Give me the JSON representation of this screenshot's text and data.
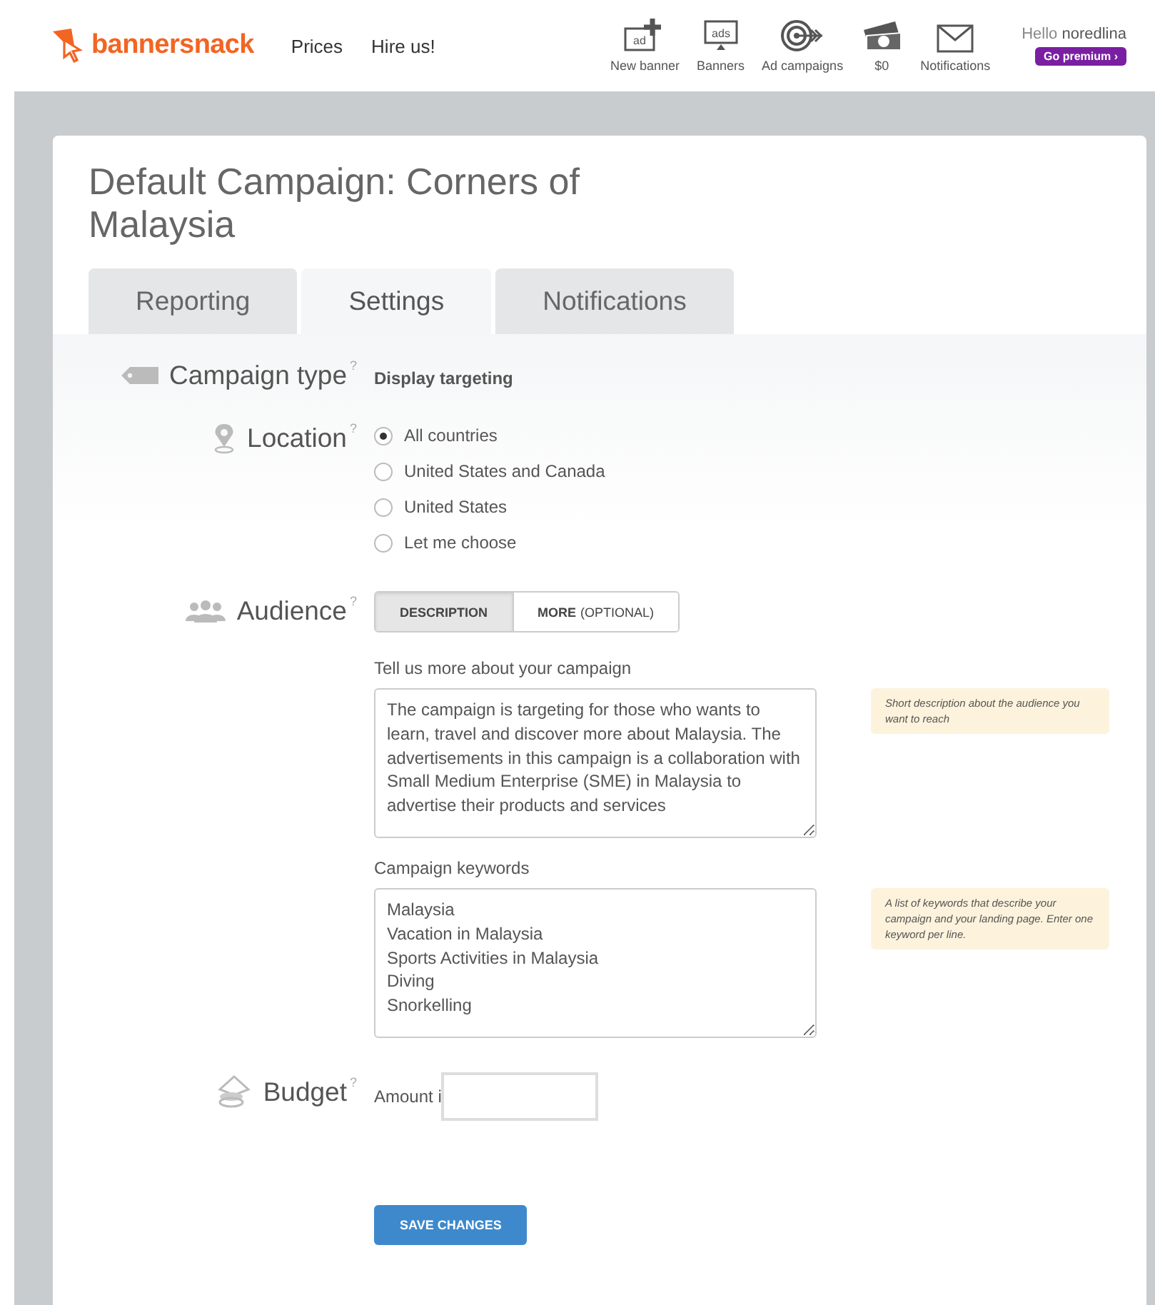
{
  "header": {
    "logo": "bannersnack",
    "nav": [
      "Prices",
      "Hire us!"
    ],
    "tools": [
      {
        "kind": "new-banner",
        "label": "New banner",
        "icon_text": "ad"
      },
      {
        "kind": "banners",
        "label": "Banners",
        "icon_text": "ads"
      },
      {
        "kind": "target",
        "label": "Ad campaigns"
      },
      {
        "kind": "money",
        "label": "$0"
      },
      {
        "kind": "mail",
        "label": "Notifications"
      }
    ],
    "user": {
      "greeting": "Hello",
      "name": "noredlina",
      "premium": "Go premium ›"
    }
  },
  "page": {
    "title": "Default Campaign: Corners of Malaysia",
    "tabs": [
      {
        "label": "Reporting",
        "selected": false
      },
      {
        "label": "Settings",
        "selected": true
      },
      {
        "label": "Notifications",
        "selected": false
      }
    ],
    "help_mark": "?",
    "campaign_type": {
      "label": "Campaign type",
      "value": "Display targeting"
    },
    "location": {
      "label": "Location",
      "options": [
        {
          "label": "All countries",
          "selected": true
        },
        {
          "label": "United States and Canada",
          "selected": false
        },
        {
          "label": "United States",
          "selected": false
        },
        {
          "label": "Let me choose",
          "selected": false
        }
      ]
    },
    "audience": {
      "label": "Audience",
      "segments": [
        {
          "label": "DESCRIPTION",
          "selected": true
        },
        {
          "label": "MORE",
          "note": "(OPTIONAL)",
          "selected": false
        }
      ],
      "description": {
        "label": "Tell us more about your campaign",
        "value": "The campaign is targeting for those who wants to learn, travel and discover more about Malaysia. The advertisements in this campaign is a collaboration with Small Medium Enterprise (SME) in Malaysia to advertise their products and services",
        "hint": "Short description about the audience you want to reach"
      },
      "keywords": {
        "label": "Campaign keywords",
        "value": "Malaysia\nVacation in Malaysia\nSports Activities in Malaysia\nDiving\nSnorkelling",
        "hint": "A list of keywords that describe your campaign and your landing page. Enter one keyword per line."
      }
    },
    "budget": {
      "label": "Budget",
      "amount_label": "Amount i"
    },
    "save": "SAVE CHANGES"
  }
}
